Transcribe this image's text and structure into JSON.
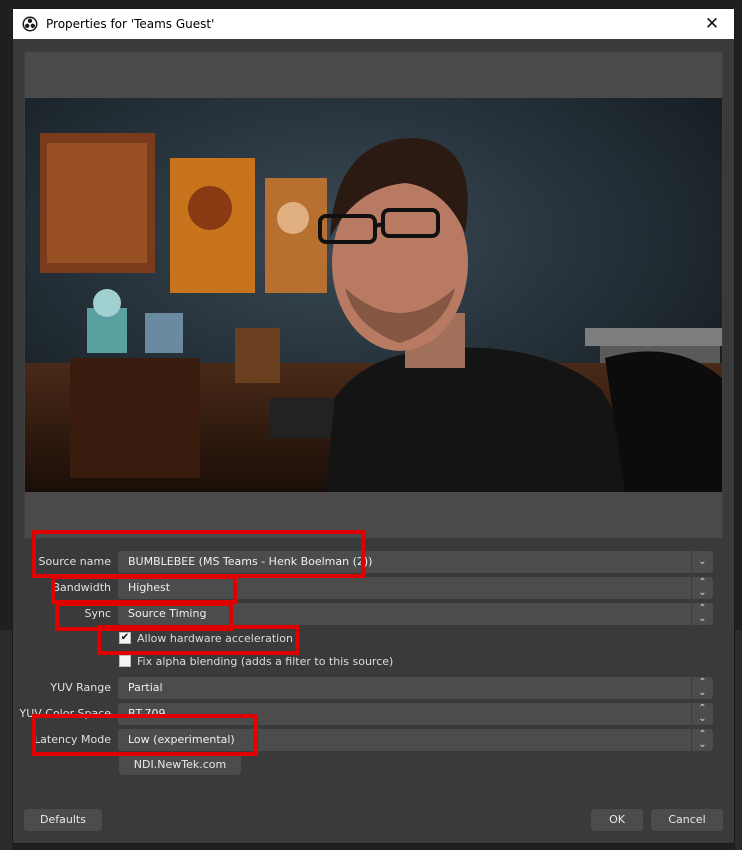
{
  "window": {
    "title": "Properties for 'Teams Guest'",
    "close_glyph": "✕"
  },
  "preview": {
    "description_icon": "video-preview"
  },
  "form": {
    "source_name": {
      "label": "Source name",
      "value": "BUMBLEBEE (MS Teams - Henk Boelman (2))"
    },
    "bandwidth": {
      "label": "Bandwidth",
      "value": "Highest"
    },
    "sync": {
      "label": "Sync",
      "value": "Source Timing"
    },
    "hw_accel": {
      "label": "Allow hardware acceleration",
      "checked": true
    },
    "alpha_blend": {
      "label": "Fix alpha blending (adds a filter to this source)",
      "checked": false
    },
    "yuv_range": {
      "label": "YUV Range",
      "value": "Partial"
    },
    "yuv_color_space": {
      "label": "YUV Color Space",
      "value": "BT.709"
    },
    "latency_mode": {
      "label": "Latency Mode",
      "value": "Low (experimental)"
    },
    "ndi_link": {
      "label": "NDI.NewTek.com"
    }
  },
  "footer": {
    "defaults_label": "Defaults",
    "ok_label": "OK",
    "cancel_label": "Cancel"
  },
  "colors": {
    "dialog_bg": "#3a3a3a",
    "field_bg": "#4c4c4c",
    "highlight": "#e00000"
  }
}
